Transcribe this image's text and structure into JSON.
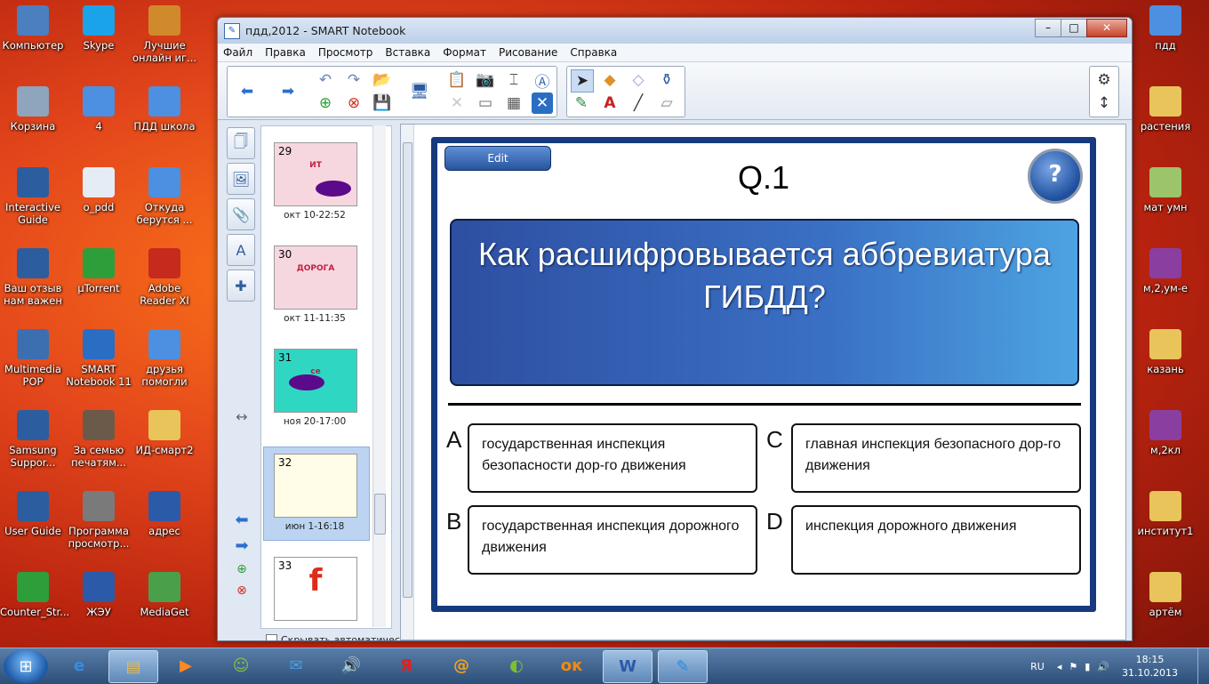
{
  "window": {
    "title": "пдд,2012 - SMART Notebook",
    "minimize": "–",
    "maximize": "□",
    "close": "✕"
  },
  "menu": [
    "Файл",
    "Правка",
    "Просмотр",
    "Вставка",
    "Формат",
    "Рисование",
    "Справка"
  ],
  "desktop_left": [
    {
      "label": "Компьютер",
      "icon": "computer-icon",
      "color": "#4a7fc0"
    },
    {
      "label": "Skype",
      "icon": "skype-icon",
      "color": "#1aa3e8"
    },
    {
      "label": "Лучшие онлайн иг...",
      "icon": "games-shortcut-icon",
      "color": "#d08a2c"
    },
    {
      "label": "Корзина",
      "icon": "recycle-bin-icon",
      "color": "#8fa4bd"
    },
    {
      "label": "4",
      "icon": "document-icon",
      "color": "#4d8fe0"
    },
    {
      "label": "ПДД школа",
      "icon": "document-icon",
      "color": "#4d8fe0"
    },
    {
      "label": "Interactive Guide",
      "icon": "interactive-guide-icon",
      "color": "#2c5d9e"
    },
    {
      "label": "o_pdd",
      "icon": "mp3-icon",
      "color": "#e6ecf5"
    },
    {
      "label": "Откуда берутся ...",
      "icon": "document-icon",
      "color": "#4d8fe0"
    },
    {
      "label": "Ваш отзыв нам важен",
      "icon": "feedback-icon",
      "color": "#2c5d9e"
    },
    {
      "label": "µTorrent",
      "icon": "utorrent-icon",
      "color": "#2e9e3a"
    },
    {
      "label": "Adobe Reader XI",
      "icon": "adobe-reader-icon",
      "color": "#c62a1c"
    },
    {
      "label": "Multimedia POP",
      "icon": "multimedia-icon",
      "color": "#3c6fb0"
    },
    {
      "label": "SMART Notebook 11",
      "icon": "smart-notebook-icon",
      "color": "#2a6ec4"
    },
    {
      "label": "друзья помогли",
      "icon": "document-icon",
      "color": "#4d8fe0"
    },
    {
      "label": "Samsung Suppor...",
      "icon": "samsung-support-icon",
      "color": "#2c5d9e"
    },
    {
      "label": "За семью печатям...",
      "icon": "mcf-icon",
      "color": "#6b5a4a"
    },
    {
      "label": "ИД-смарт2",
      "icon": "folder-icon",
      "color": "#e8c45a"
    },
    {
      "label": "User Guide",
      "icon": "user-guide-icon",
      "color": "#2c5d9e"
    },
    {
      "label": "Программа просмотр...",
      "icon": "viewer-program-icon",
      "color": "#7a7a7a"
    },
    {
      "label": "адрес",
      "icon": "word-icon",
      "color": "#2b5aa8"
    },
    {
      "label": "Counter_Str...",
      "icon": "utorrent-icon",
      "color": "#2e9e3a"
    },
    {
      "label": "ЖЭУ",
      "icon": "word-icon",
      "color": "#2b5aa8"
    },
    {
      "label": "MediaGet",
      "icon": "mediaget-icon",
      "color": "#4aa04a"
    }
  ],
  "desktop_right": [
    {
      "label": "пдд",
      "icon": "document-icon",
      "color": "#4d8fe0"
    },
    {
      "label": "растения",
      "icon": "folder-icon",
      "color": "#e8c45a"
    },
    {
      "label": "мат умн",
      "icon": "image-icon",
      "color": "#9cc46a"
    },
    {
      "label": "м,2,ум-е",
      "icon": "archive-icon",
      "color": "#8a3fa0"
    },
    {
      "label": "казань",
      "icon": "folder-icon",
      "color": "#e8c45a"
    },
    {
      "label": "м,2кл",
      "icon": "archive-icon",
      "color": "#8a3fa0"
    },
    {
      "label": "институт1",
      "icon": "folder-icon",
      "color": "#e8c45a"
    },
    {
      "label": "артём",
      "icon": "folder-icon",
      "color": "#e8c45a"
    }
  ],
  "sorter": {
    "pages": [
      {
        "num": "29",
        "caption": "окт 10-22:52",
        "bg": "#f7d7df",
        "text": "ИТ"
      },
      {
        "num": "30",
        "caption": "окт 11-11:35",
        "bg": "#f7d7df",
        "text": "ДОРОГА"
      },
      {
        "num": "31",
        "caption": "ноя 20-17:00",
        "bg": "#2fd7c3",
        "text": "се"
      },
      {
        "num": "32",
        "caption": "июн 1-16:18",
        "bg": "#fffde8",
        "text": ""
      },
      {
        "num": "33",
        "caption": "",
        "bg": "#ffffff",
        "text": "f"
      }
    ],
    "selected": "32",
    "auto_hide_label": "Скрывать автоматическ"
  },
  "quiz": {
    "edit_label": "Edit",
    "question_number": "Q.1",
    "help_label": "?",
    "question": "Как расшифровывается аббревиатура ГИБДД?",
    "answers": [
      {
        "letter": "A",
        "text": "государственная инспекция безопасности дор-го движения"
      },
      {
        "letter": "C",
        "text": "главная инспекция безопасного дор-го движения"
      },
      {
        "letter": "B",
        "text": "государственная инспекция дорожного движения"
      },
      {
        "letter": "D",
        "text": "инспекция дорожного движения"
      }
    ]
  },
  "taskbar": {
    "lang": "RU",
    "time": "18:15",
    "date": "31.10.2013",
    "items": [
      {
        "icon": "ie-icon",
        "glyph": "e",
        "color": "#3b8be0"
      },
      {
        "icon": "explorer-icon",
        "glyph": "▤",
        "color": "#e6b84a"
      },
      {
        "icon": "media-player-icon",
        "glyph": "▶",
        "color": "#ff8a1e"
      },
      {
        "icon": "messenger-icon",
        "glyph": "☺",
        "color": "#7fc24a"
      },
      {
        "icon": "mail-icon",
        "glyph": "✉",
        "color": "#4a9fe0"
      },
      {
        "icon": "volume-app-icon",
        "glyph": "🔊",
        "color": "#5aa0e0"
      },
      {
        "icon": "yandex-icon",
        "glyph": "Я",
        "color": "#e02020"
      },
      {
        "icon": "mail-ru-icon",
        "glyph": "@",
        "color": "#f0a020"
      },
      {
        "icon": "amigo-icon",
        "glyph": "◐",
        "color": "#7cc030"
      },
      {
        "icon": "odnoklassniki-icon",
        "glyph": "ок",
        "color": "#f08a10"
      },
      {
        "icon": "word-icon",
        "glyph": "W",
        "color": "#2b5aa8"
      },
      {
        "icon": "smart-notebook-icon",
        "glyph": "✎",
        "color": "#2a8ae0"
      }
    ]
  }
}
